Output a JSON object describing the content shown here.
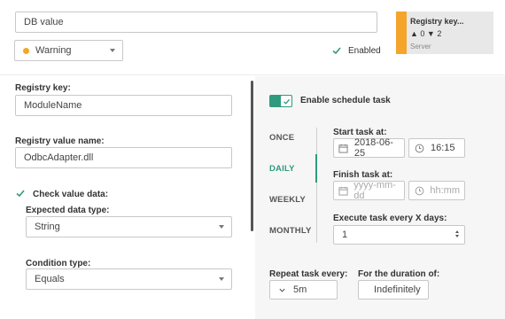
{
  "top": {
    "db_value": "DB value",
    "severity": "Warning",
    "enabled_label": "Enabled",
    "enabled_checked": true
  },
  "registry_card": {
    "title": "Registry key...",
    "counts": "▲ 0 ▼ 2",
    "subtitle": "Server",
    "accent_color": "#f4a52a"
  },
  "left": {
    "registry_key_label": "Registry key:",
    "registry_key_value": "ModuleName",
    "registry_value_name_label": "Registry value name:",
    "registry_value_name": "OdbcAdapter.dll",
    "check_value_label": "Check value data:",
    "check_value_checked": true,
    "expected_type_label": "Expected data type:",
    "expected_type": "String",
    "condition_type_label": "Condition type:",
    "condition_type": "Equals"
  },
  "schedule": {
    "enable_label": "Enable schedule task",
    "enabled": true,
    "accent_color": "#2e9b7c",
    "tabs": [
      "ONCE",
      "DAILY",
      "WEEKLY",
      "MONTHLY"
    ],
    "active_tab": "DAILY",
    "start_label": "Start task at:",
    "start_date": "2018-06-25",
    "start_time": "16:15",
    "finish_label": "Finish task at:",
    "finish_date_placeholder": "yyyy-mm-dd",
    "finish_time_placeholder": "hh:mm",
    "every_x_days_label": "Execute task every X days:",
    "every_x_days": "1",
    "repeat_label": "Repeat task every:",
    "repeat_value": "5m",
    "duration_label": "For the duration of:",
    "duration_value": "Indefinitely"
  }
}
